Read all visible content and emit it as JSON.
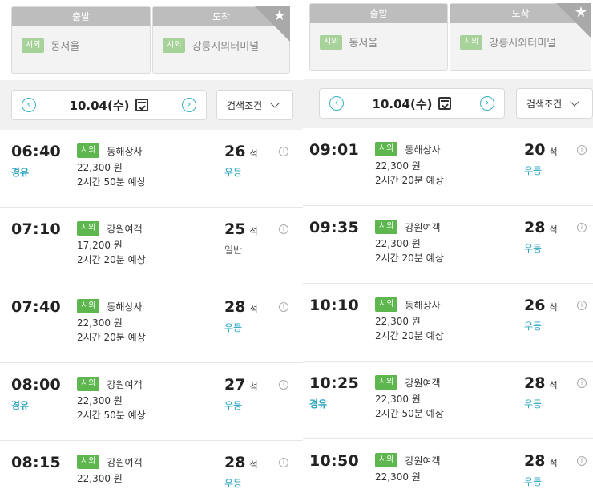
{
  "screens": [
    {
      "route": {
        "departure_label": "출발",
        "arrival_label": "도착",
        "departure_badge": "시외",
        "departure_place": "동서울",
        "arrival_badge": "시외",
        "arrival_place": "강릉시외터미널"
      },
      "date": {
        "value": "10.04",
        "weekday": "(수)"
      },
      "filter_label": "검색조건",
      "trips": [
        {
          "time": "06:40",
          "via": "경유",
          "badge": "시외",
          "company": "동해상사",
          "price": "22,300 원",
          "duration": "2시간 50분 예상",
          "seats": "26",
          "seat_unit": "석",
          "grade": "우등",
          "grade_type": "premium"
        },
        {
          "time": "07:10",
          "via": "",
          "badge": "시외",
          "company": "강원여객",
          "price": "17,200 원",
          "duration": "2시간 20분 예상",
          "seats": "25",
          "seat_unit": "석",
          "grade": "일반",
          "grade_type": "normal"
        },
        {
          "time": "07:40",
          "via": "",
          "badge": "시외",
          "company": "동해상사",
          "price": "22,300 원",
          "duration": "2시간 20분 예상",
          "seats": "28",
          "seat_unit": "석",
          "grade": "우등",
          "grade_type": "premium"
        },
        {
          "time": "08:00",
          "via": "경유",
          "badge": "시외",
          "company": "강원여객",
          "price": "22,300 원",
          "duration": "2시간 50분 예상",
          "seats": "27",
          "seat_unit": "석",
          "grade": "우등",
          "grade_type": "premium"
        },
        {
          "time": "08:15",
          "via": "",
          "badge": "시외",
          "company": "강원여객",
          "price": "22,300 원",
          "duration": "",
          "seats": "28",
          "seat_unit": "석",
          "grade": "우등",
          "grade_type": "premium"
        }
      ]
    },
    {
      "route": {
        "departure_label": "출발",
        "arrival_label": "도착",
        "departure_badge": "시외",
        "departure_place": "동서울",
        "arrival_badge": "시외",
        "arrival_place": "강릉시외터미널"
      },
      "date": {
        "value": "10.04",
        "weekday": "(수)"
      },
      "filter_label": "검색조건",
      "trips": [
        {
          "time": "09:01",
          "via": "",
          "badge": "시외",
          "company": "동해상사",
          "price": "22,300 원",
          "duration": "2시간 20분 예상",
          "seats": "20",
          "seat_unit": "석",
          "grade": "우등",
          "grade_type": "premium"
        },
        {
          "time": "09:35",
          "via": "",
          "badge": "시외",
          "company": "강원여객",
          "price": "22,300 원",
          "duration": "2시간 20분 예상",
          "seats": "28",
          "seat_unit": "석",
          "grade": "우등",
          "grade_type": "premium"
        },
        {
          "time": "10:10",
          "via": "",
          "badge": "시외",
          "company": "동해상사",
          "price": "22,300 원",
          "duration": "2시간 20분 예상",
          "seats": "26",
          "seat_unit": "석",
          "grade": "우등",
          "grade_type": "premium"
        },
        {
          "time": "10:25",
          "via": "경유",
          "badge": "시외",
          "company": "강원여객",
          "price": "22,300 원",
          "duration": "2시간 50분 예상",
          "seats": "28",
          "seat_unit": "석",
          "grade": "우등",
          "grade_type": "premium"
        },
        {
          "time": "10:50",
          "via": "",
          "badge": "시외",
          "company": "강원여객",
          "price": "22,300 원",
          "duration": "",
          "seats": "28",
          "seat_unit": "석",
          "grade": "우등",
          "grade_type": "premium"
        }
      ]
    }
  ],
  "colors": {
    "accent": "#2aa5c0",
    "badge_green": "#5eb64f",
    "badge_light_green": "#a7d39a",
    "header_gray": "#bdbdbd"
  },
  "icons": {
    "favorite": "star-icon",
    "prev_date": "chevron-left-icon",
    "next_date": "chevron-right-icon",
    "calendar": "calendar-icon",
    "filter_dropdown": "chevron-down-icon",
    "trip_info": "info-icon"
  }
}
